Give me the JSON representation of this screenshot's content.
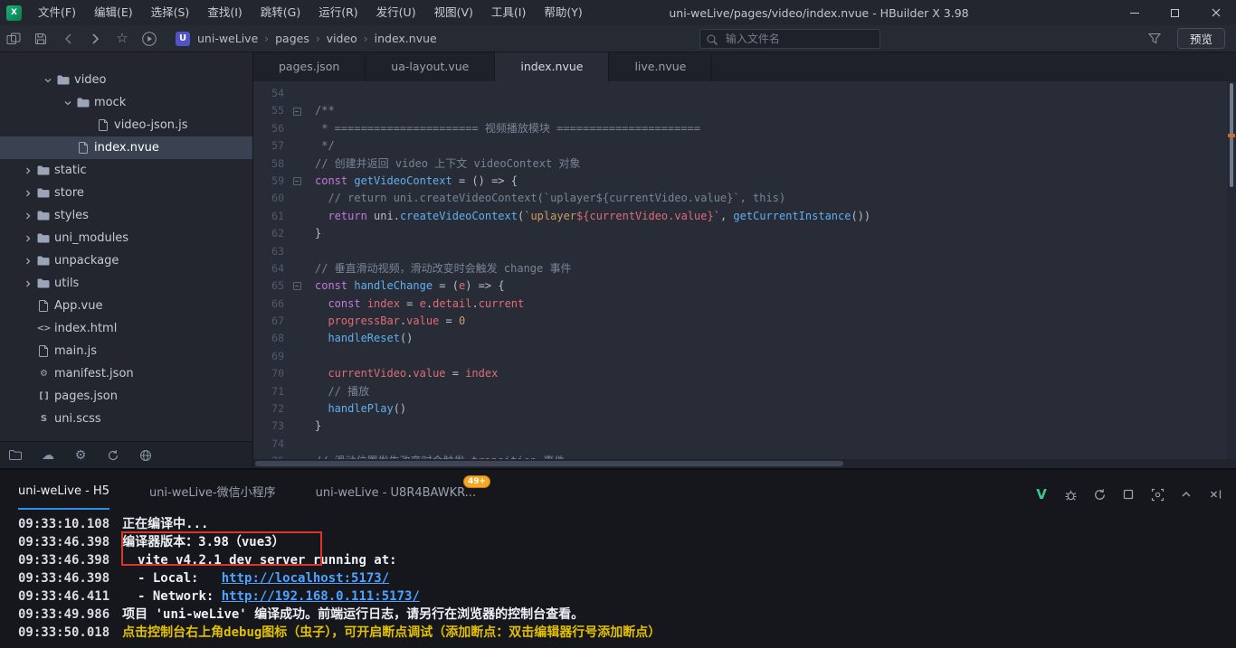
{
  "window": {
    "title": "uni-weLive/pages/video/index.nvue - HBuilder X 3.98",
    "logo_text": "X",
    "controls": [
      "minimize-icon",
      "maximize-icon",
      "close-icon"
    ]
  },
  "menu": {
    "items": [
      "文件(F)",
      "编辑(E)",
      "选择(S)",
      "查找(I)",
      "跳转(G)",
      "运行(R)",
      "发行(U)",
      "视图(V)",
      "工具(I)",
      "帮助(Y)"
    ]
  },
  "toolbar": {
    "icons": [
      "panels-icon",
      "save-icon",
      "back-icon",
      "forward-icon",
      "star-icon",
      "run-icon",
      "project-icon",
      "search-icon",
      "filter-icon"
    ],
    "breadcrumb": [
      "uni-weLive",
      "pages",
      "video",
      "index.nvue"
    ],
    "project_icon_text": "U",
    "search_placeholder": "输入文件名",
    "preview_label": "预览"
  },
  "sidebar": {
    "tree": [
      {
        "label": "video",
        "type": "folder",
        "depth": 1,
        "expanded": true
      },
      {
        "label": "mock",
        "type": "folder",
        "depth": 2,
        "expanded": true
      },
      {
        "label": "video-json.js",
        "type": "doc",
        "depth": 3
      },
      {
        "label": "index.nvue",
        "type": "doc",
        "depth": 2,
        "selected": true
      },
      {
        "label": "static",
        "type": "folder",
        "depth": 0
      },
      {
        "label": "store",
        "type": "folder",
        "depth": 0
      },
      {
        "label": "styles",
        "type": "folder",
        "depth": 0
      },
      {
        "label": "uni_modules",
        "type": "folder",
        "depth": 0
      },
      {
        "label": "unpackage",
        "type": "folder",
        "depth": 0
      },
      {
        "label": "utils",
        "type": "folder",
        "depth": 0
      },
      {
        "label": "App.vue",
        "type": "doc",
        "depth": 0
      },
      {
        "label": "index.html",
        "type": "html",
        "depth": 0
      },
      {
        "label": "main.js",
        "type": "doc",
        "depth": 0
      },
      {
        "label": "manifest.json",
        "type": "gear",
        "depth": 0
      },
      {
        "label": "pages.json",
        "type": "brackets",
        "depth": 0
      },
      {
        "label": "uni.scss",
        "type": "scss",
        "depth": 0
      }
    ],
    "bottom_icons": [
      "explorer-icon",
      "cloud-icon",
      "settings-icon",
      "refresh-icon",
      "globe-icon"
    ]
  },
  "editor": {
    "tabs": [
      {
        "label": "pages.json",
        "active": false
      },
      {
        "label": "ua-layout.vue",
        "active": false
      },
      {
        "label": "index.nvue",
        "active": true
      },
      {
        "label": "live.nvue",
        "active": false
      }
    ],
    "lines": [
      {
        "num": 54,
        "tokens": []
      },
      {
        "num": 55,
        "fold": true,
        "tokens": [
          [
            "c",
            "/**"
          ]
        ]
      },
      {
        "num": 56,
        "tokens": [
          [
            "c",
            " * ====================== 视频播放模块 ======================"
          ]
        ]
      },
      {
        "num": 57,
        "tokens": [
          [
            "c",
            " */"
          ]
        ]
      },
      {
        "num": 58,
        "tokens": [
          [
            "c",
            "// 创建并返回 video 上下文 videoContext 对象"
          ]
        ]
      },
      {
        "num": 59,
        "fold": true,
        "tokens": [
          [
            "k",
            "const "
          ],
          [
            "f",
            "getVideoContext"
          ],
          [
            "p",
            " = () => {"
          ]
        ]
      },
      {
        "num": 60,
        "tokens": [
          [
            "c",
            "  // return uni.createVideoContext(`uplayer${currentVideo.value}`, this)"
          ]
        ]
      },
      {
        "num": 61,
        "tokens": [
          [
            "p",
            "  "
          ],
          [
            "k",
            "return "
          ],
          [
            "p",
            "uni."
          ],
          [
            "f",
            "createVideoContext"
          ],
          [
            "p",
            "("
          ],
          [
            "s",
            "`uplayer"
          ],
          [
            "v",
            "${currentVideo.value}"
          ],
          [
            "s",
            "`"
          ],
          [
            "p",
            ", "
          ],
          [
            "f",
            "getCurrentInstance"
          ],
          [
            "p",
            "())"
          ]
        ]
      },
      {
        "num": 62,
        "tokens": [
          [
            "p",
            "}"
          ]
        ]
      },
      {
        "num": 63,
        "tokens": []
      },
      {
        "num": 64,
        "tokens": [
          [
            "c",
            "// 垂直滑动视频，滑动改变时会触发 change 事件"
          ]
        ]
      },
      {
        "num": 65,
        "fold": true,
        "tokens": [
          [
            "k",
            "const "
          ],
          [
            "f",
            "handleChange"
          ],
          [
            "p",
            " = ("
          ],
          [
            "v",
            "e"
          ],
          [
            "p",
            ") => {"
          ]
        ]
      },
      {
        "num": 66,
        "tokens": [
          [
            "p",
            "  "
          ],
          [
            "k",
            "const "
          ],
          [
            "v",
            "index"
          ],
          [
            "p",
            " = "
          ],
          [
            "v",
            "e"
          ],
          [
            "p",
            "."
          ],
          [
            "v",
            "detail"
          ],
          [
            "p",
            "."
          ],
          [
            "v",
            "current"
          ]
        ]
      },
      {
        "num": 67,
        "tokens": [
          [
            "p",
            "  "
          ],
          [
            "v",
            "progressBar"
          ],
          [
            "p",
            "."
          ],
          [
            "v",
            "value"
          ],
          [
            "p",
            " = "
          ],
          [
            "n",
            "0"
          ]
        ]
      },
      {
        "num": 68,
        "tokens": [
          [
            "p",
            "  "
          ],
          [
            "f",
            "handleReset"
          ],
          [
            "p",
            "()"
          ]
        ]
      },
      {
        "num": 69,
        "tokens": []
      },
      {
        "num": 70,
        "tokens": [
          [
            "p",
            "  "
          ],
          [
            "v",
            "currentVideo"
          ],
          [
            "p",
            "."
          ],
          [
            "v",
            "value"
          ],
          [
            "p",
            " = "
          ],
          [
            "v",
            "index"
          ]
        ]
      },
      {
        "num": 71,
        "tokens": [
          [
            "p",
            "  "
          ],
          [
            "c",
            "// 播放"
          ]
        ]
      },
      {
        "num": 72,
        "tokens": [
          [
            "p",
            "  "
          ],
          [
            "f",
            "handlePlay"
          ],
          [
            "p",
            "()"
          ]
        ]
      },
      {
        "num": 73,
        "tokens": [
          [
            "p",
            "}"
          ]
        ]
      },
      {
        "num": 74,
        "tokens": []
      },
      {
        "num": 75,
        "tokens": [
          [
            "c",
            "// 滑动位置发生改变时会触发 transition 事件"
          ]
        ]
      }
    ]
  },
  "console": {
    "tabs": [
      {
        "label": "uni-weLive - H5",
        "active": true
      },
      {
        "label": "uni-weLive-微信小程序",
        "active": false
      },
      {
        "label": "uni-weLive - U8R4BAWKR...",
        "active": false,
        "badge": "49+"
      }
    ],
    "header_icons": [
      "vue-indicator-icon",
      "debug-bug-icon",
      "restart-icon",
      "stop-icon",
      "screenshot-icon",
      "collapse-panel-icon",
      "close-console-icon"
    ],
    "lines": [
      {
        "time": "09:33:10.108",
        "segments": [
          {
            "text": "正在编译中...",
            "style": "normal"
          }
        ]
      },
      {
        "time": "09:33:46.398",
        "segments": [
          {
            "text": "编译器版本：3.98（vue3）",
            "style": "normal"
          }
        ],
        "highlighted": true
      },
      {
        "time": "09:33:46.398",
        "segments": [
          {
            "text": "  vite v4.2.1 dev server running at:",
            "style": "normal"
          }
        ]
      },
      {
        "time": "09:33:46.398",
        "segments": [
          {
            "text": "  - Local:   ",
            "style": "normal"
          },
          {
            "text": "http://localhost:5173/",
            "style": "link"
          }
        ]
      },
      {
        "time": "09:33:46.411",
        "segments": [
          {
            "text": "  - Network: ",
            "style": "normal"
          },
          {
            "text": "http://192.168.0.111:5173/",
            "style": "link"
          }
        ]
      },
      {
        "time": "09:33:49.986",
        "segments": [
          {
            "text": "项目 'uni-weLive' 编译成功。前端运行日志，请另行在浏览器的控制台查看。",
            "style": "normal"
          }
        ]
      },
      {
        "time": "09:33:50.018",
        "segments": [
          {
            "text": "点击控制台右上角debug图标（虫子），可开启断点调试（添加断点：双击编辑器行号添加断点）",
            "style": "warning"
          }
        ]
      }
    ],
    "annotation": {
      "color": "#e0342b",
      "target_text": "编译器版本：3.98（vue3）"
    }
  }
}
